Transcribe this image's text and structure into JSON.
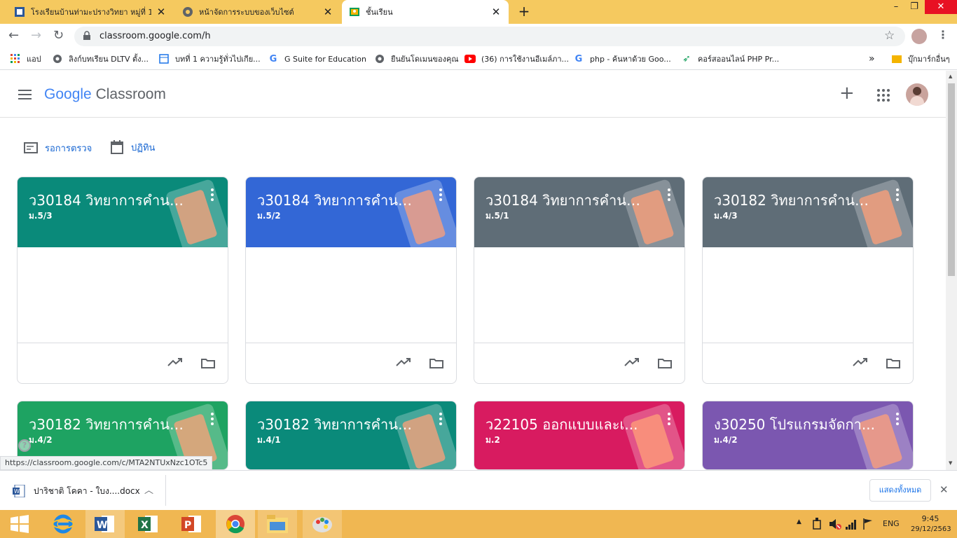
{
  "browser": {
    "tabs": [
      {
        "title": "โรงเรียนบ้านท่ามะปรางวิทยา หมู่ที่ 1 ต...",
        "icon": "word-doc-icon",
        "active": false
      },
      {
        "title": "หน้าจัดการระบบของเว็บไซต์",
        "icon": "globe-icon",
        "active": false
      },
      {
        "title": "ชั้นเรียน",
        "icon": "classroom-icon",
        "active": true
      }
    ],
    "url": "classroom.google.com/h",
    "bookmarks": [
      {
        "label": "แอป",
        "icon": "apps-grid-icon"
      },
      {
        "label": "ลิงก์บทเรียน DLTV ตั้ง...",
        "icon": "globe-icon"
      },
      {
        "label": "บทที่ 1 ความรู้ทั่วไปเกีย...",
        "icon": "doc-icon"
      },
      {
        "label": "G Suite for Education",
        "icon": "google-icon"
      },
      {
        "label": "ยืนยันโดเมนของคุณ",
        "icon": "globe-icon"
      },
      {
        "label": "(36) การใช้งานอีเมล์ภา...",
        "icon": "youtube-icon"
      },
      {
        "label": "php - ค้นหาด้วย Goo...",
        "icon": "google-icon"
      },
      {
        "label": "คอร์สออนไลน์ PHP Pr...",
        "icon": "arrow-icon"
      }
    ],
    "more_bookmarks_label": "»",
    "other_bookmarks_label": "บุ๊กมาร์กอื่นๆ"
  },
  "app": {
    "logo_google": "Google",
    "logo_product": "Classroom",
    "links": [
      {
        "label": "รอการตรวจ",
        "icon": "to-review-icon"
      },
      {
        "label": "ปฏิทิน",
        "icon": "calendar-icon"
      }
    ]
  },
  "cards": [
    {
      "title": "ว30184 วิทยาการคำนว...",
      "section": "ม.5/3",
      "color": "#0a8a7a"
    },
    {
      "title": "ว30184 วิทยาการคำนว...",
      "section": "ม.5/2",
      "color": "#3367d6"
    },
    {
      "title": "ว30184 วิทยาการคำนว...",
      "section": "ม.5/1",
      "color": "#5f6d77"
    },
    {
      "title": "ว30182 วิทยาการคำนว...",
      "section": "ม.4/3",
      "color": "#5f6d77"
    },
    {
      "title": "ว30182 วิทยาการคำนว...",
      "section": "ม.4/2",
      "color": "#1ea362"
    },
    {
      "title": "ว30182 วิทยาการคำนว...",
      "section": "ม.4/1",
      "color": "#0a8a7a"
    },
    {
      "title": "ว22105 ออกแบบและเ...",
      "section": "ม.2",
      "color": "#d81b60"
    },
    {
      "title": "ง30250 โปรแกรมจัดกา...",
      "section": "ม.4/2",
      "color": "#7b57b0"
    }
  ],
  "status_url": "https://classroom.google.com/c/MTA2NTUxNzc1OTc5",
  "download": {
    "filename": "ปาริชาติ โคคา - ใบง....docx",
    "show_all": "แสดงทั้งหมด"
  },
  "taskbar": {
    "apps": [
      "start-icon",
      "internet-explorer-icon",
      "word-icon",
      "excel-icon",
      "powerpoint-icon",
      "chrome-icon",
      "file-explorer-icon",
      "paint-icon"
    ],
    "lang": "ENG",
    "time": "9:45",
    "date": "29/12/2563"
  }
}
